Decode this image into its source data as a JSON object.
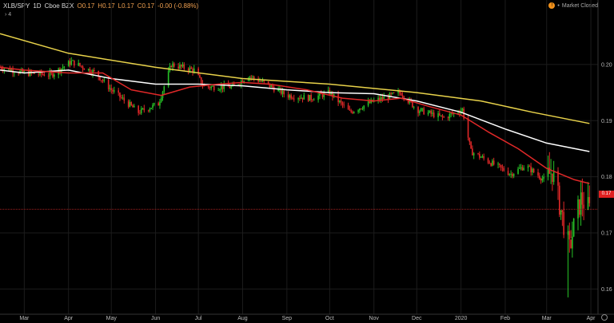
{
  "header": {
    "symbol": "XLB/SPY",
    "interval": "1D",
    "exchange": "Cboe BZX",
    "open": "O0.17",
    "high": "H0.17",
    "low": "L0.17",
    "close": "C0.17",
    "change": "-0.00 (-0.88%)",
    "indicator_count": "4",
    "market_status": "Market Closed"
  },
  "price_tag": "0.17",
  "chart_data": {
    "type": "candlestick",
    "title": "",
    "xlabel": "",
    "ylabel": "",
    "ylim": [
      0.1555,
      0.2115
    ],
    "y_ticks": [
      0.16,
      0.17,
      0.18,
      0.19,
      0.2
    ],
    "y_tick_labels": [
      "0.16",
      "0.17",
      "0.18",
      "0.19",
      "0.20"
    ],
    "x_range": [
      "2019-02-12",
      "2020-04-06"
    ],
    "x_ticks": [
      {
        "label": "Mar",
        "date": "2019-03-01"
      },
      {
        "label": "Apr",
        "date": "2019-04-01"
      },
      {
        "label": "May",
        "date": "2019-05-01"
      },
      {
        "label": "Jun",
        "date": "2019-06-01"
      },
      {
        "label": "Jul",
        "date": "2019-07-01"
      },
      {
        "label": "Aug",
        "date": "2019-08-01"
      },
      {
        "label": "Sep",
        "date": "2019-09-01"
      },
      {
        "label": "Oct",
        "date": "2019-10-01"
      },
      {
        "label": "Nov",
        "date": "2019-11-01"
      },
      {
        "label": "Dec",
        "date": "2019-12-01"
      },
      {
        "label": "2020",
        "date": "2020-01-01"
      },
      {
        "label": "Feb",
        "date": "2020-02-01"
      },
      {
        "label": "Mar",
        "date": "2020-03-01"
      },
      {
        "label": "Apr",
        "date": "2020-04-01"
      }
    ],
    "last_price_line": 0.1742,
    "price_path": [
      [
        "2019-02-12",
        0.1995
      ],
      [
        "2019-03-01",
        0.1985
      ],
      [
        "2019-03-20",
        0.1982
      ],
      [
        "2019-04-03",
        0.2005
      ],
      [
        "2019-04-20",
        0.1985
      ],
      [
        "2019-05-01",
        0.1955
      ],
      [
        "2019-05-20",
        0.1915
      ],
      [
        "2019-06-03",
        0.193
      ],
      [
        "2019-06-12",
        0.2
      ],
      [
        "2019-06-28",
        0.199
      ],
      [
        "2019-07-05",
        0.196
      ],
      [
        "2019-07-25",
        0.196
      ],
      [
        "2019-08-05",
        0.198
      ],
      [
        "2019-08-18",
        0.1965
      ],
      [
        "2019-09-01",
        0.1945
      ],
      [
        "2019-09-18",
        0.194
      ],
      [
        "2019-10-01",
        0.195
      ],
      [
        "2019-10-15",
        0.1915
      ],
      [
        "2019-11-01",
        0.1935
      ],
      [
        "2019-11-20",
        0.195
      ],
      [
        "2019-12-01",
        0.192
      ],
      [
        "2019-12-20",
        0.1905
      ],
      [
        "2020-01-02",
        0.192
      ],
      [
        "2020-01-08",
        0.1845
      ],
      [
        "2020-01-22",
        0.1825
      ],
      [
        "2020-02-05",
        0.1805
      ],
      [
        "2020-02-15",
        0.182
      ],
      [
        "2020-02-28",
        0.1795
      ],
      [
        "2020-03-05",
        0.181
      ],
      [
        "2020-03-11",
        0.174
      ],
      [
        "2020-03-17",
        0.167
      ],
      [
        "2020-03-20",
        0.171
      ],
      [
        "2020-03-25",
        0.176
      ],
      [
        "2020-03-31",
        0.1742
      ]
    ],
    "series": [
      {
        "color": "#e8d24a",
        "values": [
          [
            "2019-02-12",
            0.2055
          ],
          [
            "2019-04-01",
            0.202
          ],
          [
            "2019-06-01",
            0.1995
          ],
          [
            "2019-08-01",
            0.1975
          ],
          [
            "2019-10-01",
            0.1965
          ],
          [
            "2019-12-01",
            0.195
          ],
          [
            "2020-01-15",
            0.1935
          ],
          [
            "2020-02-20",
            0.1915
          ],
          [
            "2020-03-31",
            0.1895
          ]
        ]
      },
      {
        "color": "#ffffff",
        "values": [
          [
            "2019-02-12",
            0.199
          ],
          [
            "2019-03-01",
            0.1985
          ],
          [
            "2019-04-01",
            0.199
          ],
          [
            "2019-05-01",
            0.1975
          ],
          [
            "2019-06-01",
            0.1965
          ],
          [
            "2019-07-01",
            0.1965
          ],
          [
            "2019-08-01",
            0.1962
          ],
          [
            "2019-09-01",
            0.1955
          ],
          [
            "2019-10-01",
            0.195
          ],
          [
            "2019-11-01",
            0.1948
          ],
          [
            "2019-12-01",
            0.1935
          ],
          [
            "2020-01-01",
            0.1915
          ],
          [
            "2020-02-01",
            0.1885
          ],
          [
            "2020-03-01",
            0.186
          ],
          [
            "2020-03-31",
            0.1845
          ]
        ]
      },
      {
        "color": "#e02828",
        "values": [
          [
            "2019-02-12",
            0.1995
          ],
          [
            "2019-03-01",
            0.199
          ],
          [
            "2019-04-01",
            0.1985
          ],
          [
            "2019-04-25",
            0.1985
          ],
          [
            "2019-05-15",
            0.1955
          ],
          [
            "2019-06-05",
            0.1945
          ],
          [
            "2019-06-25",
            0.196
          ],
          [
            "2019-07-15",
            0.1965
          ],
          [
            "2019-08-01",
            0.1968
          ],
          [
            "2019-08-20",
            0.1965
          ],
          [
            "2019-09-15",
            0.1955
          ],
          [
            "2019-10-10",
            0.194
          ],
          [
            "2019-11-01",
            0.1935
          ],
          [
            "2019-11-20",
            0.194
          ],
          [
            "2019-12-10",
            0.1925
          ],
          [
            "2020-01-01",
            0.191
          ],
          [
            "2020-01-20",
            0.188
          ],
          [
            "2020-02-10",
            0.185
          ],
          [
            "2020-03-01",
            0.1815
          ],
          [
            "2020-03-20",
            0.1795
          ],
          [
            "2020-03-31",
            0.1788
          ]
        ]
      }
    ],
    "grid": true,
    "legend": "none"
  }
}
